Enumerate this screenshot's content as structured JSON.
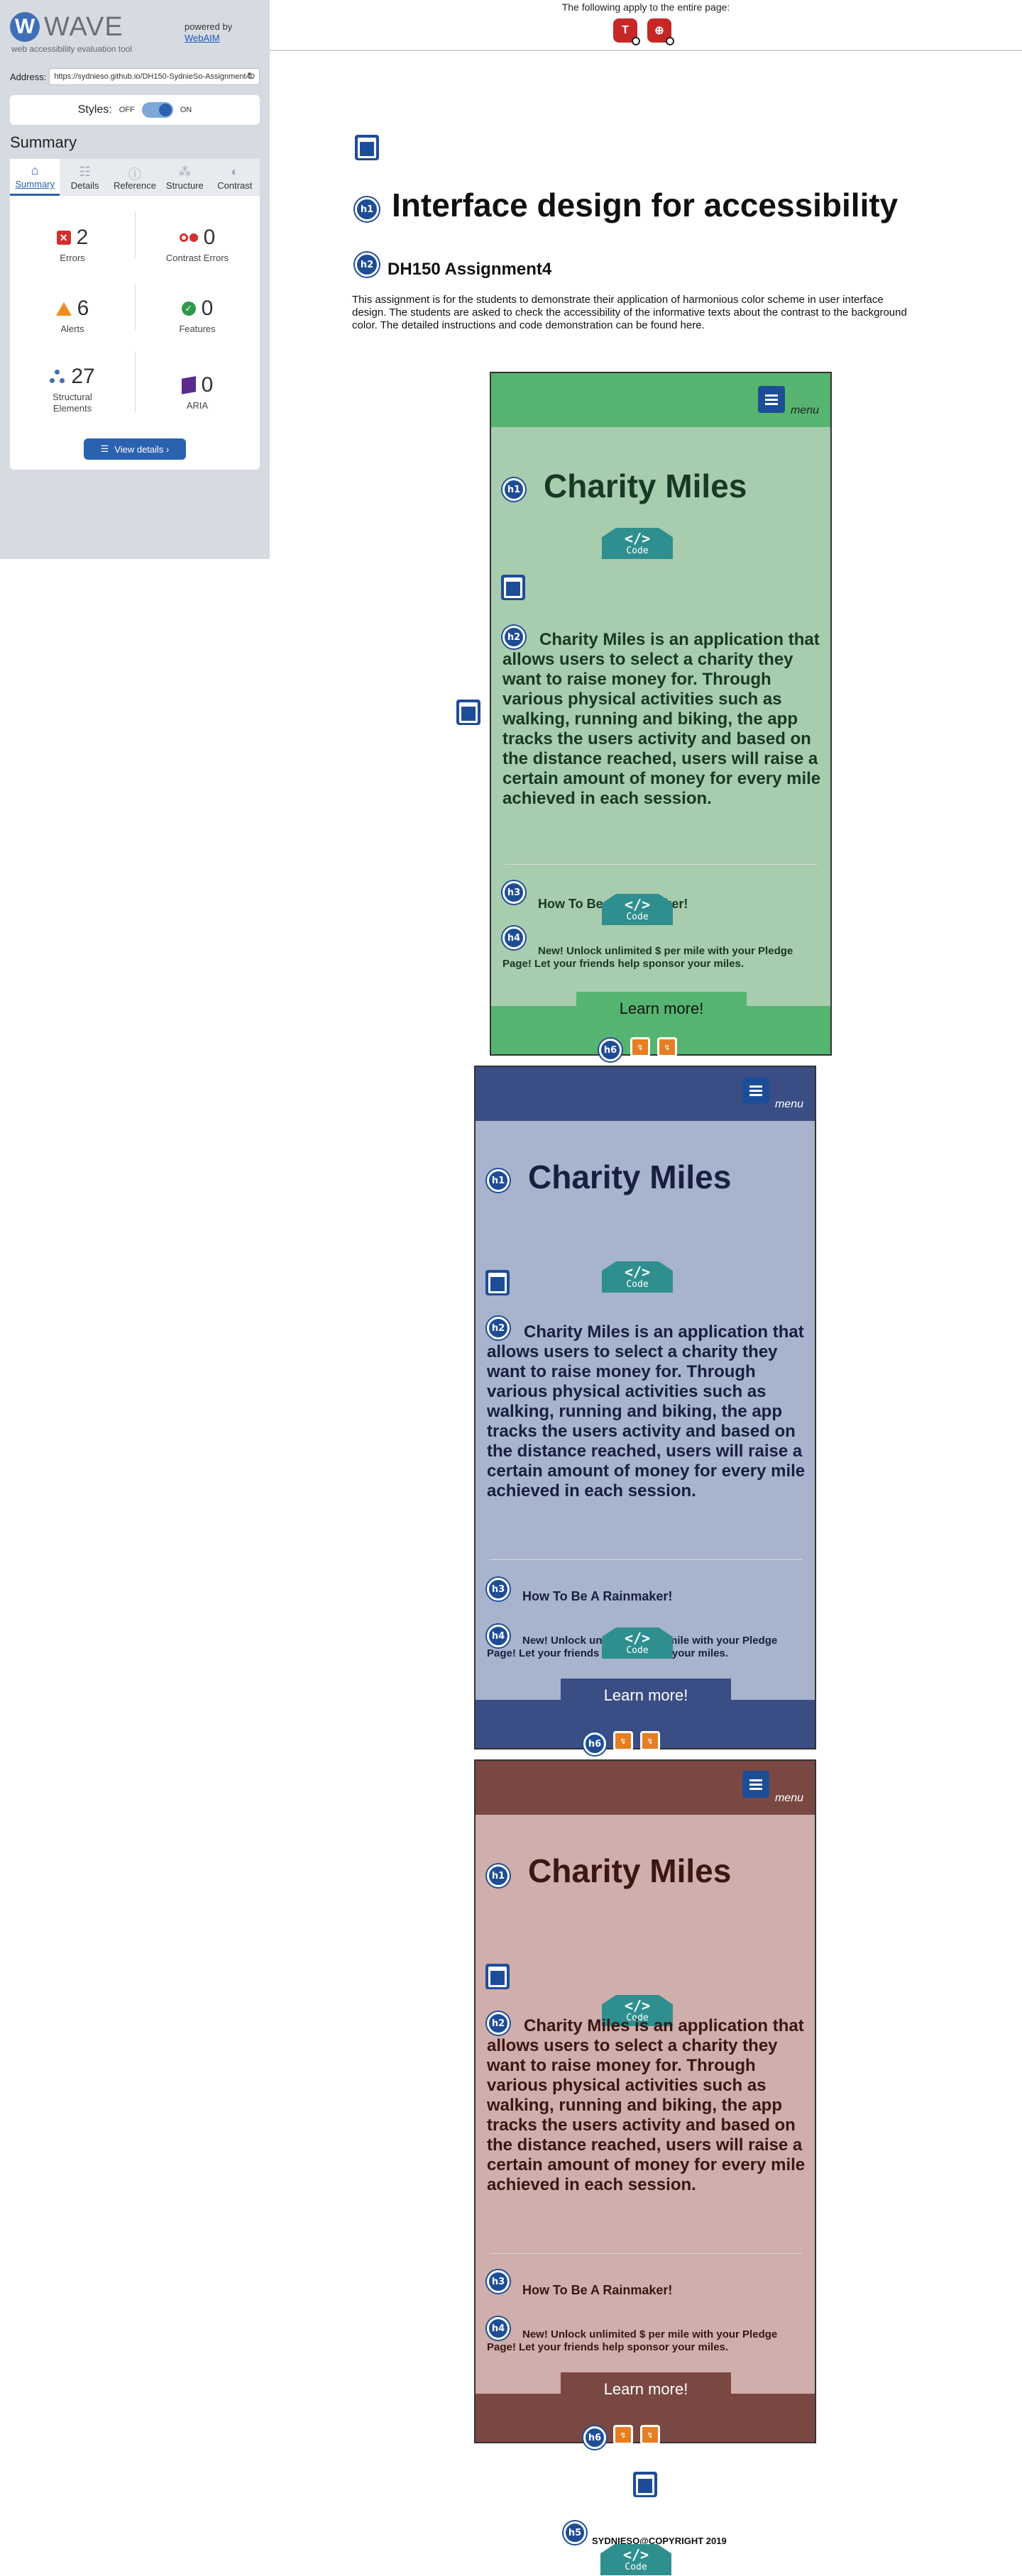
{
  "wave": {
    "brand": "WAVE",
    "tagline": "web accessibility evaluation tool",
    "powered_by": "powered by",
    "webaim": "WebAIM",
    "address_label": "Address:",
    "address_value": "https://sydnieso.github.io/DH150-SydnieSo-Assignment4/",
    "styles_label": "Styles:",
    "styles_off": "OFF",
    "styles_on": "ON",
    "summary_title": "Summary",
    "tabs": [
      "Summary",
      "Details",
      "Reference",
      "Structure",
      "Contrast"
    ],
    "stats": {
      "errors": {
        "value": "2",
        "label": "Errors"
      },
      "contrast_errors": {
        "value": "0",
        "label": "Contrast Errors"
      },
      "alerts": {
        "value": "6",
        "label": "Alerts"
      },
      "features": {
        "value": "0",
        "label": "Features"
      },
      "structural": {
        "value": "27",
        "label": "Structural Elements"
      },
      "aria": {
        "value": "0",
        "label": "ARIA"
      }
    },
    "view_details": "View details ›"
  },
  "page_icons": {
    "note": "The following apply to the entire page:",
    "icons": [
      "T",
      "⊕"
    ]
  },
  "badges": {
    "h1": "h1",
    "h2": "h2",
    "h3": "h3",
    "h4": "h4",
    "h5": "h5",
    "h6": "h6",
    "code": "Code",
    "code_glyph": "</>"
  },
  "page": {
    "h1": "Interface design for accessibility",
    "h2": "DH150 Assignment4",
    "intro": "This assignment is for the students to demonstrate their application of harmonious color scheme in user interface design. The students are asked to check the accessibility of the informative texts about the contrast to the background color. The detailed instructions and code demonstration can be found here.",
    "copyright": "SYDNIESO@COPYRIGHT 2019"
  },
  "phone": {
    "menu": "menu",
    "title": "Charity Miles",
    "description": "Charity Miles is an application that allows users to select a charity they want to raise money for. Through various physical activities such as walking, running and biking, the app tracks the users activity and based on the distance reached, users will raise a certain amount of money for every mile achieved in each session.",
    "rainmaker": "How To Be A Rainmaker!",
    "pledge": "New! Unlock unlimited $ per mile with your Pledge Page! Let your friends help sponsor your miles.",
    "learn_more": "Learn more!"
  },
  "colors": {
    "green_header": "#55b570",
    "green_body": "#a8ccae",
    "blue_header": "#3a4d84",
    "blue_body": "#a8b3cd",
    "red_header": "#7a4843",
    "red_body": "#cfaeab"
  }
}
